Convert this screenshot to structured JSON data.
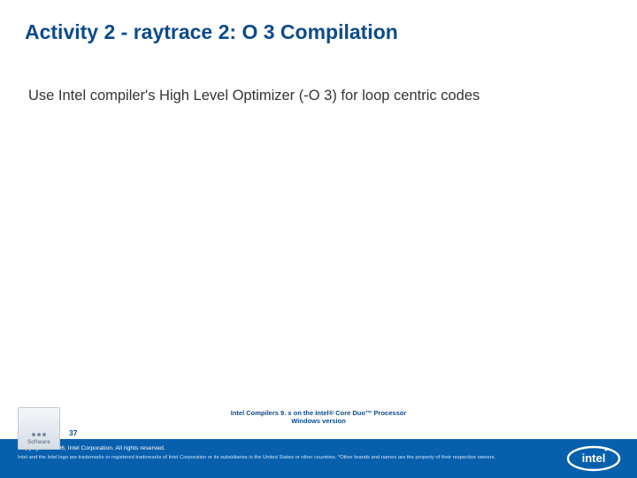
{
  "slide": {
    "title": "Activity 2 - raytrace 2: O 3 Compilation",
    "body": "Use Intel compiler's High Level Optimizer (-O 3) for loop centric codes",
    "page_number": "37"
  },
  "footer": {
    "meta_line1": "Intel Compilers 9. x on the Intel® Core Duo™ Processor",
    "meta_line2": "Windows version",
    "copyright": "Copyright © 2006, Intel Corporation. All rights reserved.",
    "disclaimer": "Intel and the Intel logo are trademarks or registered trademarks of Intel Corporation or its subsidiaries in the United States or other countries. *Other brands and names are the property of their respective owners.",
    "software_badge_label": "Software",
    "logo_text": "intel"
  },
  "colors": {
    "title_color": "#0c4a8c",
    "footer_bg": "#0860ad"
  }
}
